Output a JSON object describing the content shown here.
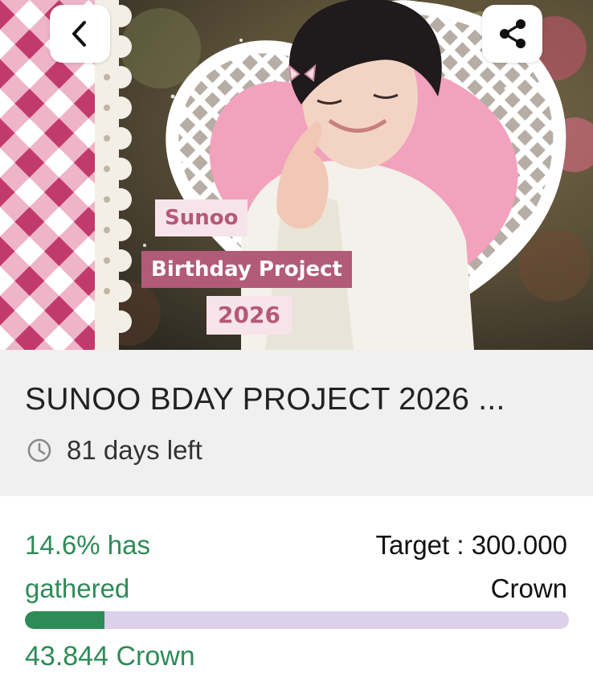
{
  "banner": {
    "tag_name": "Sunoo",
    "tag_project": "Birthday Project",
    "tag_year": "2026",
    "back_icon": "chevron-left-icon",
    "share_icon": "share-icon"
  },
  "project": {
    "title": "SUNOO BDAY PROJECT 2026 ...",
    "days_left": "81 days left"
  },
  "funding": {
    "gathered_label": "14.6% has gathered",
    "target_label": "Target : 300.000 Crown",
    "collected_label": "43.844 Crown",
    "progress_fraction": 0.146
  },
  "colors": {
    "accent_green": "#2e8b57",
    "bar_track": "#ddd0ea",
    "tag_pink": "#b25b79"
  }
}
